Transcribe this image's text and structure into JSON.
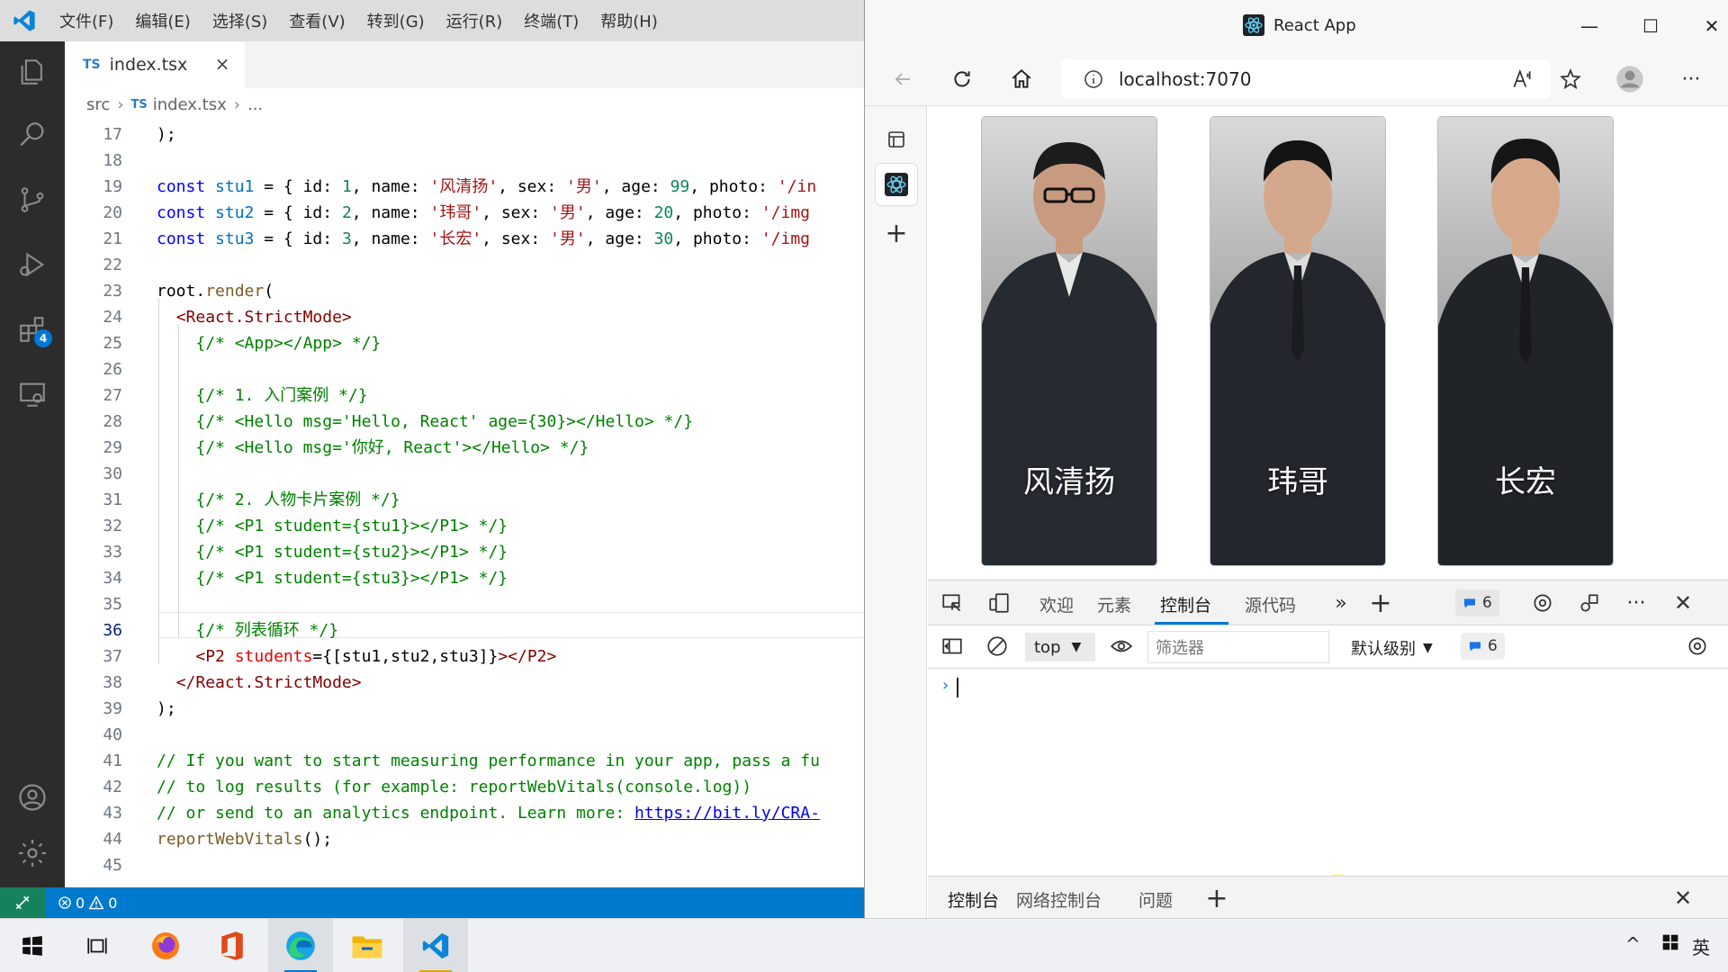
{
  "vscode": {
    "menu": [
      "文件(F)",
      "编辑(E)",
      "选择(S)",
      "查看(V)",
      "转到(G)",
      "运行(R)",
      "终端(T)",
      "帮助(H)"
    ],
    "extensions_badge": "4",
    "tab": {
      "type_badge": "TS",
      "filename": "index.tsx"
    },
    "breadcrumb": {
      "folder": "src",
      "file": "index.tsx",
      "more": "..."
    },
    "status": {
      "errors": "0",
      "warnings": "0"
    },
    "lines": [
      {
        "n": "17",
        "tokens": [
          [
            "",
            ");"
          ]
        ]
      },
      {
        "n": "18",
        "tokens": []
      },
      {
        "n": "19",
        "tokens": [
          [
            "kw",
            "const "
          ],
          [
            "var",
            "stu1"
          ],
          [
            "",
            " = { id: "
          ],
          [
            "num",
            "1"
          ],
          [
            "",
            ", name: "
          ],
          [
            "str",
            "'风清扬'"
          ],
          [
            "",
            ", sex: "
          ],
          [
            "str",
            "'男'"
          ],
          [
            "",
            ", age: "
          ],
          [
            "num",
            "99"
          ],
          [
            "",
            ", photo: "
          ],
          [
            "str",
            "'/in"
          ]
        ]
      },
      {
        "n": "20",
        "tokens": [
          [
            "kw",
            "const "
          ],
          [
            "var",
            "stu2"
          ],
          [
            "",
            " = { id: "
          ],
          [
            "num",
            "2"
          ],
          [
            "",
            ", name: "
          ],
          [
            "str",
            "'玮哥'"
          ],
          [
            "",
            ", sex: "
          ],
          [
            "str",
            "'男'"
          ],
          [
            "",
            ", age: "
          ],
          [
            "num",
            "20"
          ],
          [
            "",
            ", photo: "
          ],
          [
            "str",
            "'/img"
          ]
        ]
      },
      {
        "n": "21",
        "tokens": [
          [
            "kw",
            "const "
          ],
          [
            "var",
            "stu3"
          ],
          [
            "",
            " = { id: "
          ],
          [
            "num",
            "3"
          ],
          [
            "",
            ", name: "
          ],
          [
            "str",
            "'长宏'"
          ],
          [
            "",
            ", sex: "
          ],
          [
            "str",
            "'男'"
          ],
          [
            "",
            ", age: "
          ],
          [
            "num",
            "30"
          ],
          [
            "",
            ", photo: "
          ],
          [
            "str",
            "'/img"
          ]
        ]
      },
      {
        "n": "22",
        "tokens": []
      },
      {
        "n": "23",
        "tokens": [
          [
            "",
            "root."
          ],
          [
            "fn",
            "render"
          ],
          [
            "",
            "("
          ]
        ]
      },
      {
        "n": "24",
        "tokens": [
          [
            "",
            "  "
          ],
          [
            "tag",
            "<React.StrictMode>"
          ]
        ]
      },
      {
        "n": "25",
        "tokens": [
          [
            "",
            "    "
          ],
          [
            "cm",
            "{/* <App></App> */}"
          ]
        ]
      },
      {
        "n": "26",
        "tokens": []
      },
      {
        "n": "27",
        "tokens": [
          [
            "",
            "    "
          ],
          [
            "cm",
            "{/* 1. 入门案例 */}"
          ]
        ]
      },
      {
        "n": "28",
        "tokens": [
          [
            "",
            "    "
          ],
          [
            "cm",
            "{/* <Hello msg='Hello, React' age={30}></Hello> */}"
          ]
        ]
      },
      {
        "n": "29",
        "tokens": [
          [
            "",
            "    "
          ],
          [
            "cm",
            "{/* <Hello msg='你好, React'></Hello> */}"
          ]
        ]
      },
      {
        "n": "30",
        "tokens": []
      },
      {
        "n": "31",
        "tokens": [
          [
            "",
            "    "
          ],
          [
            "cm",
            "{/* 2. 人物卡片案例 */}"
          ]
        ]
      },
      {
        "n": "32",
        "tokens": [
          [
            "",
            "    "
          ],
          [
            "cm",
            "{/* <P1 student={stu1}></P1> */}"
          ]
        ]
      },
      {
        "n": "33",
        "tokens": [
          [
            "",
            "    "
          ],
          [
            "cm",
            "{/* <P1 student={stu2}></P1> */}"
          ]
        ]
      },
      {
        "n": "34",
        "tokens": [
          [
            "",
            "    "
          ],
          [
            "cm",
            "{/* <P1 student={stu3}></P1> */}"
          ]
        ]
      },
      {
        "n": "35",
        "tokens": []
      },
      {
        "n": "36",
        "tokens": [
          [
            "",
            "    "
          ],
          [
            "cm",
            "{/* 列表循环 */}"
          ]
        ]
      },
      {
        "n": "37",
        "tokens": [
          [
            "",
            "    "
          ],
          [
            "tag",
            "<P2 "
          ],
          [
            "attr",
            "students"
          ],
          [
            "",
            "={[stu1,stu2,stu3]}"
          ],
          [
            "tag",
            "></P2>"
          ]
        ]
      },
      {
        "n": "38",
        "tokens": [
          [
            "",
            "  "
          ],
          [
            "tag",
            "</React.StrictMode>"
          ]
        ]
      },
      {
        "n": "39",
        "tokens": [
          [
            "",
            ");"
          ]
        ]
      },
      {
        "n": "40",
        "tokens": []
      },
      {
        "n": "41",
        "tokens": [
          [
            "cm",
            "// If you want to start measuring performance in your app, pass a fu"
          ]
        ]
      },
      {
        "n": "42",
        "tokens": [
          [
            "cm",
            "// to log results (for example: reportWebVitals(console.log))"
          ]
        ]
      },
      {
        "n": "43",
        "tokens": [
          [
            "cm",
            "// or send to an analytics endpoint. Learn more: "
          ],
          [
            "link",
            "https://bit.ly/CRA-"
          ]
        ]
      },
      {
        "n": "44",
        "tokens": [
          [
            "fn",
            "reportWebVitals"
          ],
          [
            "",
            "();"
          ]
        ]
      },
      {
        "n": "45",
        "tokens": []
      }
    ]
  },
  "browser": {
    "title": "React App",
    "url": "localhost:7070",
    "cards": [
      {
        "name": "风清扬"
      },
      {
        "name": "玮哥"
      },
      {
        "name": "长宏"
      }
    ],
    "devtools": {
      "tabs": [
        "欢迎",
        "元素",
        "控制台",
        "源代码"
      ],
      "issues_count": "6",
      "context": "top",
      "filter_placeholder": "筛选器",
      "level": "默认级别",
      "msg_count": "6",
      "prompt": "›",
      "drawer_tabs": [
        "控制台",
        "网络控制台",
        "问题"
      ]
    }
  },
  "taskbar": {
    "ime": "英"
  },
  "colors": {
    "vscode_blue": "#007acc",
    "edge_accent": "#0078d4"
  }
}
